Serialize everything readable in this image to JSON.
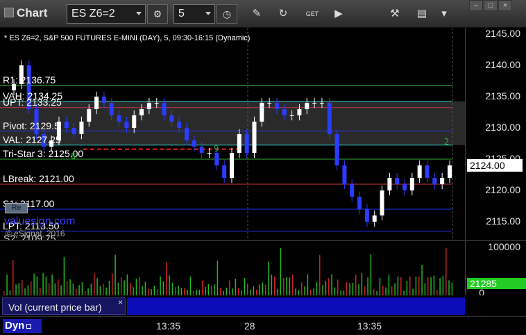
{
  "toolbar": {
    "title": "Chart",
    "symbol": "ES Z6=2",
    "interval": "5",
    "icons": [
      "gear-icon",
      "clock-icon",
      "pencil-icon",
      "refresh-icon",
      "get-icon",
      "play-icon",
      "tool-icon",
      "comment-icon",
      "minimize-icon",
      "maximize-icon",
      "close-icon"
    ]
  },
  "chart": {
    "description": "* ES Z6=2, S&P 500 FUTURES E-MINI (DAY), 5, 09:30-16:15 (Dynamic)",
    "price_axis": [
      "2145.00",
      "2140.00",
      "2135.00",
      "2130.00",
      "2125.00",
      "2120.00",
      "2115.00"
    ],
    "current_price": "2124.00",
    "levels": [
      {
        "label": "R1: 2136.75",
        "color": "#3acc3a"
      },
      {
        "label": "VAH: 2134.25",
        "color": "#33cccc"
      },
      {
        "label": "UPT: 2133.25",
        "color": "#cc3355"
      },
      {
        "label": "Pivot: 2129.5",
        "color": "#2233ff"
      },
      {
        "label": "VAL: 2127.25",
        "color": "#33cccc"
      },
      {
        "label": "Tri-Star 3: 2125.00",
        "color": "#33aa33"
      },
      {
        "label": "LBreak: 2121.00",
        "color": "#cc3333"
      },
      {
        "label": "S1: 2117.00",
        "color": "#2233ff"
      },
      {
        "label": "LPT: 2113.50",
        "color": "#2233ff"
      }
    ],
    "level_values_overlay": [
      "2133.25"
    ],
    "price_value_label_r1": "2133.25",
    "watermark": "valuesign.com",
    "copyright": "© eSignal, 2016",
    "s2_label": "S2: 2109.75",
    "pill_label": "Re",
    "signals": [
      "6",
      "9",
      "2"
    ],
    "chart_data": {
      "type": "candlestick",
      "ylim": [
        2112,
        2146
      ],
      "series_name": "ES Z6=2",
      "closes": [
        2137,
        2140,
        2133,
        2129,
        2127,
        2128,
        2131,
        2130,
        2129,
        2131,
        2133,
        2135,
        2134,
        2132,
        2131,
        2130,
        2132,
        2133,
        2134,
        2134,
        2132,
        2131,
        2130,
        2128,
        2127,
        2126,
        2126,
        2124,
        2122,
        2126,
        2129,
        2126,
        2131,
        2134,
        2134,
        2133,
        2132,
        2132,
        2133,
        2134,
        2134,
        2134,
        2129,
        2124,
        2121,
        2119,
        2117,
        2115,
        2116,
        2120,
        2122,
        2121,
        2120,
        2122,
        2124,
        2122,
        2121,
        2122,
        2124
      ],
      "volume_axis": [
        "100000",
        "0"
      ],
      "volume_current": "21285"
    }
  },
  "vol_pane": {
    "tab_label": "Vol (current price bar)",
    "close": "×"
  },
  "time_axis": {
    "labels": [
      "13:35",
      "28",
      "13:35"
    ],
    "dyn_label": "Dyn"
  }
}
